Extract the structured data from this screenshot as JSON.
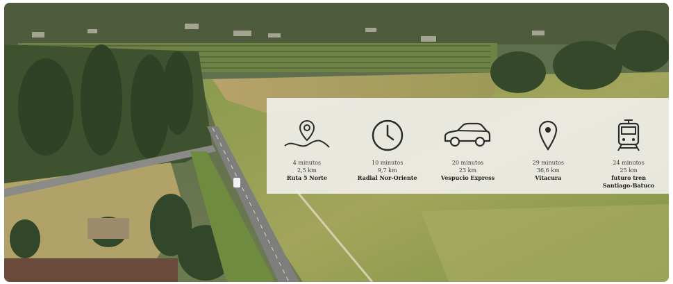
{
  "stats": [
    {
      "icon": "map-pin-road-icon",
      "time": "4 minutos",
      "distance": "2,5 km",
      "name": "Ruta 5 Norte",
      "name2": ""
    },
    {
      "icon": "clock-icon",
      "time": "10 minutos",
      "distance": "9,7 km",
      "name": "Radial Nor-Oriente",
      "name2": ""
    },
    {
      "icon": "car-icon",
      "time": "20 minutos",
      "distance": "23 km",
      "name": "Vespucio Express",
      "name2": ""
    },
    {
      "icon": "location-pin-icon",
      "time": "29 minutos",
      "distance": "36,6 km",
      "name": "Vitacura",
      "name2": ""
    },
    {
      "icon": "train-icon",
      "time": "24 minutos",
      "distance": "25 km",
      "name": "futuro tren",
      "name2": "Santiago-Batuco"
    }
  ]
}
